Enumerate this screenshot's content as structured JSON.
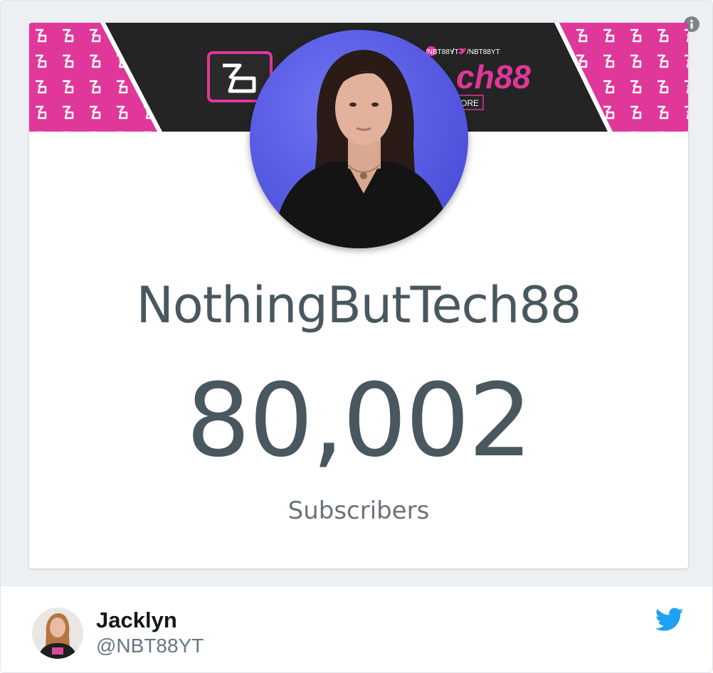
{
  "card": {
    "channel_name": "NothingButTech88",
    "subscriber_count": "80,002",
    "subscriber_label": "Subscribers"
  },
  "banner": {
    "handle_left": "/NBT88YT",
    "separator": "/",
    "handle_right": "/NBT88YT",
    "title_fragment": "ch88",
    "button_fragment": "ORE"
  },
  "author": {
    "name": "Jacklyn",
    "handle": "@NBT88YT"
  },
  "icons": {
    "info": "info-icon",
    "twitter": "twitter-bird-icon",
    "logo": "nbt-logo-icon"
  },
  "colors": {
    "banner_pink": "#e0379a",
    "banner_dark": "#242424",
    "avatar_bg": "#5b5ee8",
    "text_main": "#49575f",
    "twitter_blue": "#1da1f2"
  }
}
